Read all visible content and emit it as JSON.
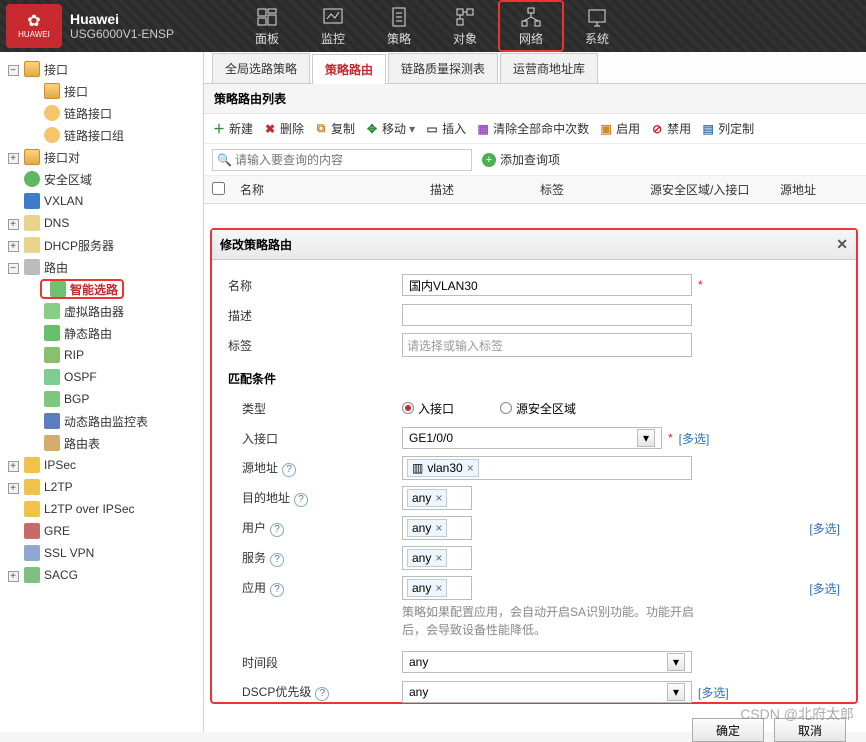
{
  "brand": {
    "logo_text": "HUAWEI",
    "line1": "Huawei",
    "line2": "USG6000V1-ENSP"
  },
  "top_tabs": {
    "dashboard": "面板",
    "monitor": "监控",
    "policy": "策略",
    "object": "对象",
    "network": "网络",
    "system": "系统"
  },
  "tree": {
    "interface": "接口",
    "interface_sub": "接口",
    "link_if": "链路接口",
    "link_if_group": "链路接口组",
    "if_pair": "接口对",
    "sec_zone": "安全区域",
    "vxlan": "VXLAN",
    "dns": "DNS",
    "dhcp": "DHCP服务器",
    "route": "路由",
    "smart_route": "智能选路",
    "vrouter": "虚拟路由器",
    "static": "静态路由",
    "rip": "RIP",
    "ospf": "OSPF",
    "bgp": "BGP",
    "dyn_table": "动态路由监控表",
    "rt_table": "路由表",
    "ipsec": "IPSec",
    "l2tp": "L2TP",
    "l2tp_ipsec": "L2TP over IPSec",
    "gre": "GRE",
    "sslvpn": "SSL VPN",
    "sacg": "SACG"
  },
  "content_tabs": {
    "t1": "全局选路策略",
    "t2": "策略路由",
    "t3": "链路质量探测表",
    "t4": "运营商地址库"
  },
  "panel_title": "策略路由列表",
  "toolbar": {
    "new": "新建",
    "delete": "删除",
    "copy": "复制",
    "move": "移动",
    "insert": "插入",
    "clear": "清除全部命中次数",
    "enable": "启用",
    "disable": "禁用",
    "cols": "列定制"
  },
  "search": {
    "placeholder": "请输入要查询的内容",
    "add_query": "添加查询项"
  },
  "grid": {
    "name": "名称",
    "desc": "描述",
    "tag": "标签",
    "src": "源安全区域/入接口",
    "src_addr": "源地址"
  },
  "dialog": {
    "title": "修改策略路由",
    "name_label": "名称",
    "name_value": "国内VLAN30",
    "desc_label": "描述",
    "tag_label": "标签",
    "tag_placeholder": "请选择或输入标签",
    "match_section": "匹配条件",
    "type_label": "类型",
    "type_in": "入接口",
    "type_zone": "源安全区域",
    "in_if_label": "入接口",
    "in_if_value": "GE1/0/0",
    "src_addr_label": "源地址",
    "src_addr_chip": "vlan30",
    "dst_addr_label": "目的地址",
    "dst_addr_chip": "any",
    "user_label": "用户",
    "user_chip": "any",
    "service_label": "服务",
    "service_chip": "any",
    "app_label": "应用",
    "app_chip": "any",
    "app_hint": "策略如果配置应用，会自动开启SA识别功能。功能开启后，会导致设备性能降低。",
    "time_label": "时间段",
    "time_value": "any",
    "dscp_label": "DSCP优先级",
    "dscp_value": "any",
    "more": "[多选]",
    "ok": "确定",
    "cancel": "取消"
  },
  "watermark": "CSDN @北府太郎"
}
